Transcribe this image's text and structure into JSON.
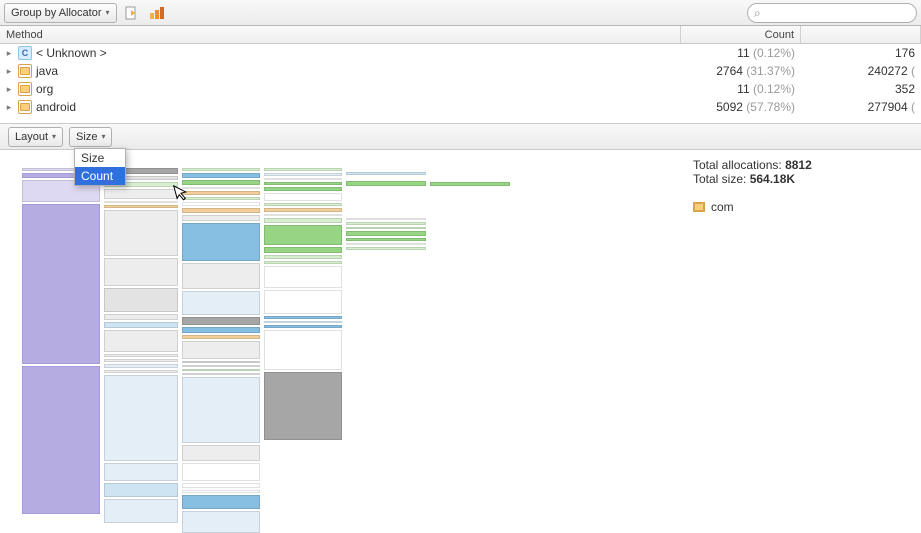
{
  "toolbar": {
    "group_label": "Group by Allocator",
    "search_placeholder": ""
  },
  "columns": {
    "method": "Method",
    "count": "Count",
    "third": ""
  },
  "rows": [
    {
      "icon": "class",
      "name": "< Unknown >",
      "count": "11",
      "pct": "(0.12%)",
      "third": "176",
      "third_ex": ""
    },
    {
      "icon": "package",
      "name": "java",
      "count": "2764",
      "pct": "(31.37%)",
      "third": "240272",
      "third_ex": "("
    },
    {
      "icon": "package",
      "name": "org",
      "count": "11",
      "pct": "(0.12%)",
      "third": "352",
      "third_ex": ""
    },
    {
      "icon": "package",
      "name": "android",
      "count": "5092",
      "pct": "(57.78%)",
      "third": "277904",
      "third_ex": "("
    }
  ],
  "sub_toolbar": {
    "layout_label": "Layout",
    "size_label": "Size"
  },
  "dropdown": {
    "items": [
      "Size",
      "Count"
    ],
    "selected_index": 1
  },
  "summary": {
    "total_alloc_label": "Total allocations: ",
    "total_alloc_value": "8812",
    "total_size_label": "Total size: ",
    "total_size_value": "564.18K",
    "entry_icon": "package",
    "entry_label": "com"
  },
  "icons": {
    "class": "C",
    "chevron_right": "▸",
    "chevron_down": "▾",
    "magnifier": "⌕"
  }
}
